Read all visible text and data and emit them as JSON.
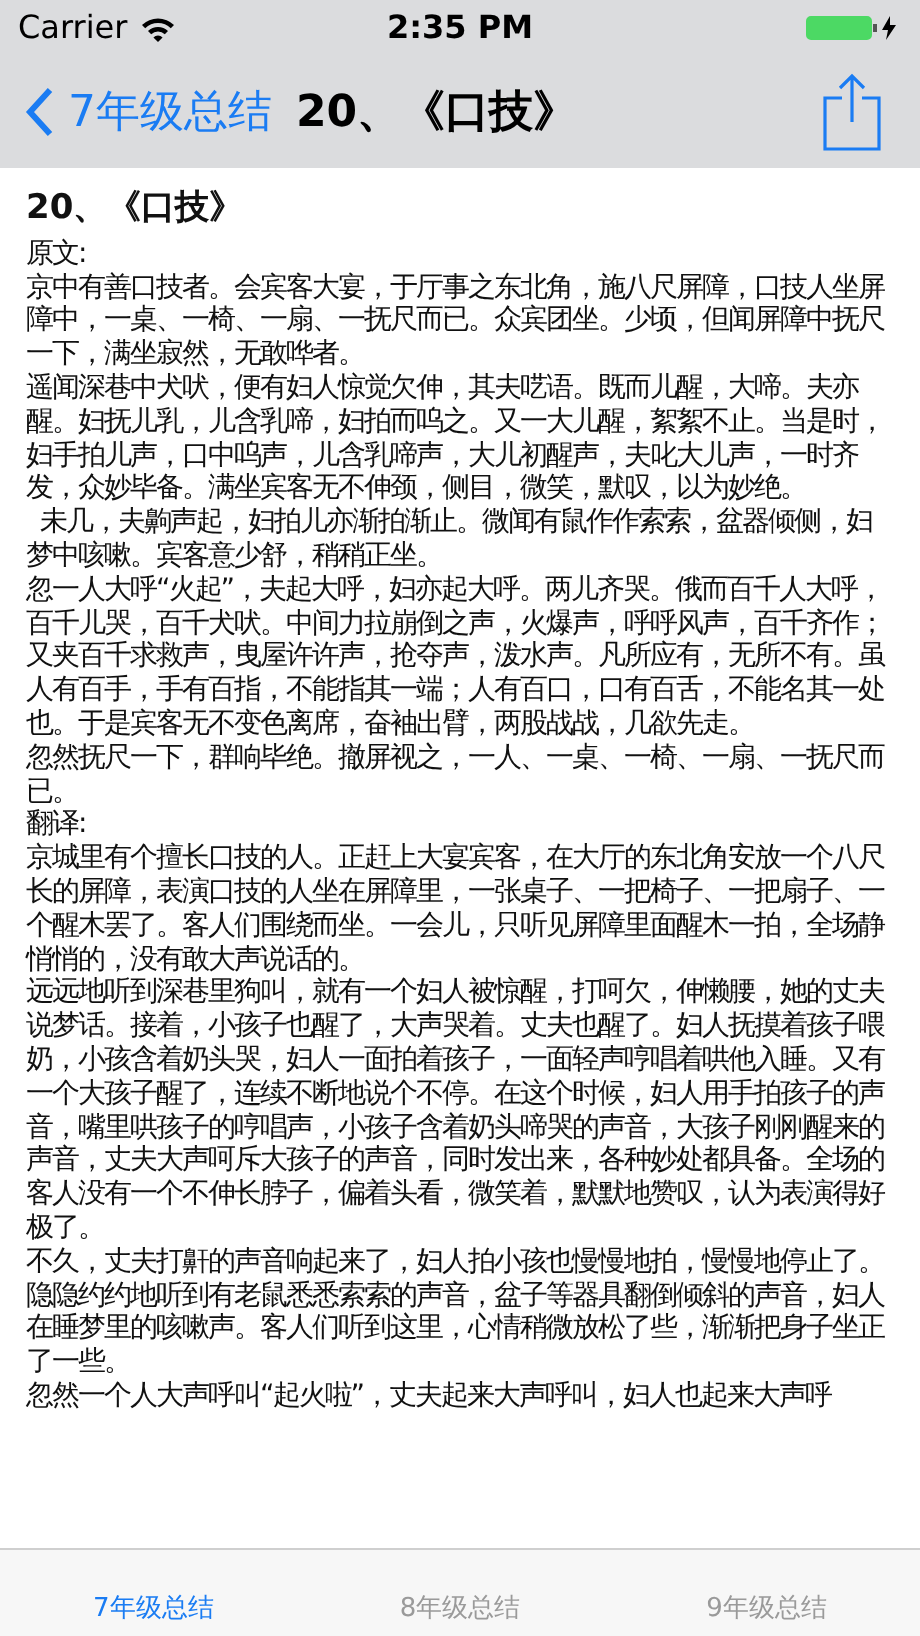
{
  "status_bar": {
    "carrier": "Carrier",
    "time": "2:35 PM"
  },
  "nav_bar": {
    "back_label": "7年级总结",
    "title": "20、《口技》"
  },
  "article": {
    "title": "20、《口技》",
    "sections": [
      {
        "heading": "原文:",
        "paragraphs": [
          "京中有善口技者。会宾客大宴，于厅事之东北角，施八尺屏障，口技人坐屏障中，一桌、一椅、一扇、一抚尺而已。众宾团坐。少顷，但闻屏障中抚尺一下，满坐寂然，无敢哗者。",
          "遥闻深巷中犬吠，便有妇人惊觉欠伸，其夫呓语。既而儿醒，大啼。夫亦醒。妇抚儿乳，儿含乳啼，妇拍而呜之。又一大儿醒，絮絮不止。当是时，妇手拍儿声，口中呜声，儿含乳啼声，大儿初醒声，夫叱大儿声，一时齐发，众妙毕备。满坐宾客无不伸颈，侧目，微笑，默叹，以为妙绝。",
          "  未几，夫齁声起，妇拍儿亦渐拍渐止。微闻有鼠作作索索，盆器倾侧，妇梦中咳嗽。宾客意少舒，稍稍正坐。",
          "忽一人大呼“火起”，夫起大呼，妇亦起大呼。两儿齐哭。俄而百千人大呼，百千儿哭，百千犬吠。中间力拉崩倒之声，火爆声，呼呼风声，百千齐作；又夹百千求救声，曳屋许许声，抢夺声，泼水声。凡所应有，无所不有。虽人有百手，手有百指，不能指其一端；人有百口，口有百舌，不能名其一处也。于是宾客无不变色离席，奋袖出臂，两股战战，几欲先走。",
          "忽然抚尺一下，群响毕绝。撤屏视之，一人、一桌、一椅、一扇、一抚尺而已。"
        ]
      },
      {
        "heading": "翻译:",
        "paragraphs": [
          "京城里有个擅长口技的人。正赶上大宴宾客，在大厅的东北角安放一个八尺长的屏障，表演口技的人坐在屏障里，一张桌子、一把椅子、一把扇子、一个醒木罢了。客人们围绕而坐。一会儿，只听见屏障里面醒木一拍，全场静悄悄的，没有敢大声说话的。",
          "远远地听到深巷里狗叫，就有一个妇人被惊醒，打呵欠，伸懒腰，她的丈夫说梦话。接着，小孩子也醒了，大声哭着。丈夫也醒了。妇人抚摸着孩子喂奶，小孩含着奶头哭，妇人一面拍着孩子，一面轻声哼唱着哄他入睡。又有一个大孩子醒了，连续不断地说个不停。在这个时候，妇人用手拍孩子的声音，嘴里哄孩子的哼唱声，小孩子含着奶头啼哭的声音，大孩子刚刚醒来的声音，丈夫大声呵斥大孩子的声音，同时发出来，各种妙处都具备。全场的客人没有一个不伸长脖子，偏着头看，微笑着，默默地赞叹，认为表演得好极了。",
          "不久，丈夫打鼾的声音响起来了，妇人拍小孩也慢慢地拍，慢慢地停止了。隐隐约约地听到有老鼠悉悉索索的声音，盆子等器具翻倒倾斜的声音，妇人在睡梦里的咳嗽声。客人们听到这里，心情稍微放松了些，渐渐把身子坐正了一些。",
          "忽然一个人大声呼叫“起火啦”，丈夫起来大声呼叫，妇人也起来大声呼"
        ]
      }
    ]
  },
  "tab_bar": [
    {
      "label": "7年级总结",
      "selected": true
    },
    {
      "label": "8年级总结",
      "selected": false
    },
    {
      "label": "9年级总结",
      "selected": false
    }
  ]
}
